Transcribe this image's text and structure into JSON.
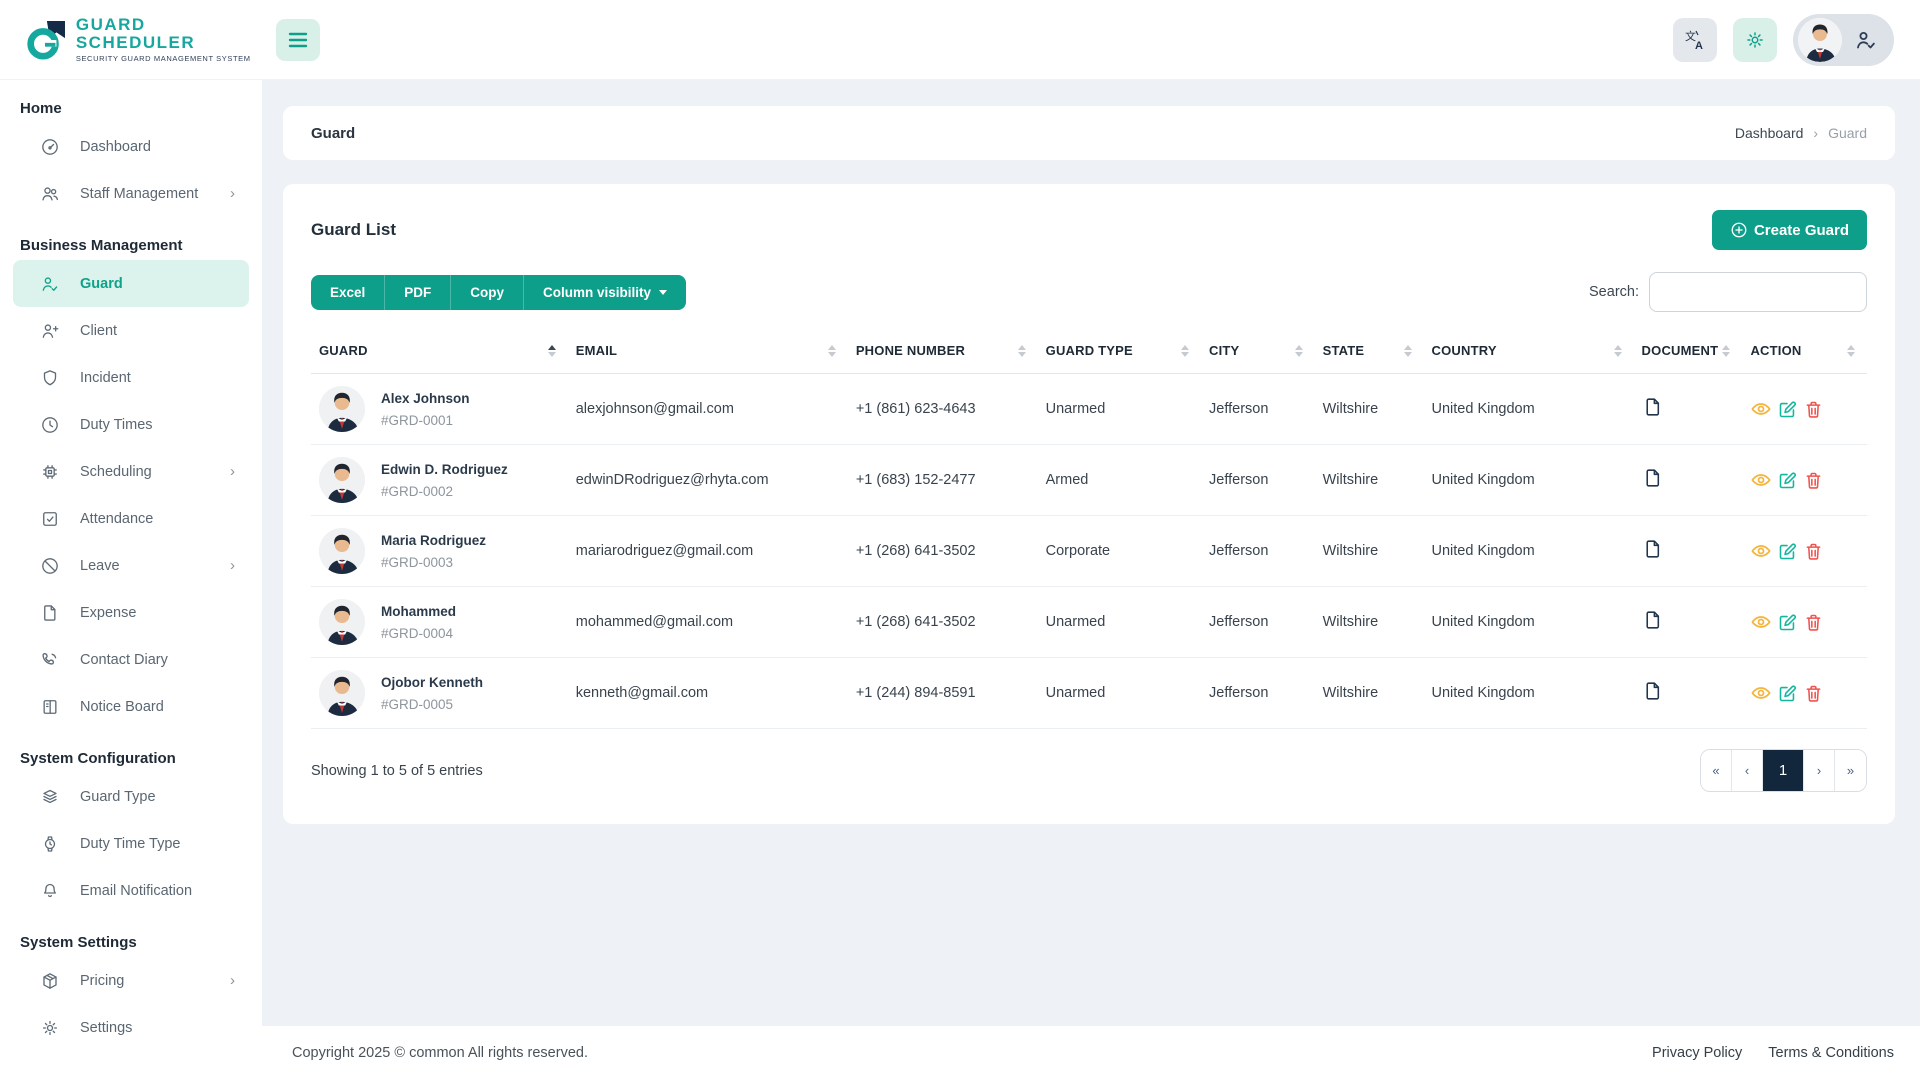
{
  "brand": {
    "title": "GUARD SCHEDULER",
    "subtitle": "SECURITY GUARD MANAGEMENT SYSTEM"
  },
  "topbar": {
    "icons": [
      "hamburger-icon",
      "translate-icon",
      "gear-icon",
      "avatar",
      "user-check-icon"
    ]
  },
  "sidebar": {
    "sections": [
      {
        "label": "Home",
        "items": [
          {
            "label": "Dashboard",
            "icon": "dashboard-icon",
            "chevron": false,
            "active": false
          },
          {
            "label": "Staff Management",
            "icon": "people-icon",
            "chevron": true,
            "active": false
          }
        ]
      },
      {
        "label": "Business Management",
        "items": [
          {
            "label": "Guard",
            "icon": "person-check-icon",
            "chevron": false,
            "active": true
          },
          {
            "label": "Client",
            "icon": "person-plus-icon",
            "chevron": false,
            "active": false
          },
          {
            "label": "Incident",
            "icon": "shield-icon",
            "chevron": false,
            "active": false
          },
          {
            "label": "Duty Times",
            "icon": "clock-icon",
            "chevron": false,
            "active": false
          },
          {
            "label": "Scheduling",
            "icon": "cpu-icon",
            "chevron": true,
            "active": false
          },
          {
            "label": "Attendance",
            "icon": "check-square-icon",
            "chevron": false,
            "active": false
          },
          {
            "label": "Leave",
            "icon": "slash-circle-icon",
            "chevron": true,
            "active": false
          },
          {
            "label": "Expense",
            "icon": "file-icon",
            "chevron": false,
            "active": false
          },
          {
            "label": "Contact Diary",
            "icon": "phone-icon",
            "chevron": false,
            "active": false
          },
          {
            "label": "Notice Board",
            "icon": "board-icon",
            "chevron": false,
            "active": false
          }
        ]
      },
      {
        "label": "System Configuration",
        "items": [
          {
            "label": "Guard Type",
            "icon": "layers-icon",
            "chevron": false,
            "active": false
          },
          {
            "label": "Duty Time Type",
            "icon": "watch-icon",
            "chevron": false,
            "active": false
          },
          {
            "label": "Email Notification",
            "icon": "bell-icon",
            "chevron": false,
            "active": false
          }
        ]
      },
      {
        "label": "System Settings",
        "items": [
          {
            "label": "Pricing",
            "icon": "package-icon",
            "chevron": true,
            "active": false
          },
          {
            "label": "Settings",
            "icon": "gear-icon",
            "chevron": false,
            "active": false
          }
        ]
      }
    ]
  },
  "breadcrumb": {
    "title": "Guard",
    "items": [
      "Dashboard",
      "Guard"
    ],
    "separator": "›"
  },
  "card": {
    "title": "Guard List",
    "create_label": "Create Guard"
  },
  "toolbar": {
    "export_buttons": [
      "Excel",
      "PDF",
      "Copy"
    ],
    "colvis_label": "Column visibility",
    "search_label": "Search:",
    "search_value": ""
  },
  "table": {
    "headers": [
      "GUARD",
      "EMAIL",
      "PHONE NUMBER",
      "GUARD TYPE",
      "CITY",
      "STATE",
      "COUNTRY",
      "DOCUMENT",
      "ACTION"
    ],
    "rows": [
      {
        "name": "Alex Johnson",
        "id": "#GRD-0001",
        "email": "alexjohnson@gmail.com",
        "phone": "+1 (861) 623-4643",
        "type": "Unarmed",
        "city": "Jefferson",
        "state": "Wiltshire",
        "country": "United Kingdom"
      },
      {
        "name": "Edwin D. Rodriguez",
        "id": "#GRD-0002",
        "email": "edwinDRodriguez@rhyta.com",
        "phone": "+1 (683) 152-2477",
        "type": "Armed",
        "city": "Jefferson",
        "state": "Wiltshire",
        "country": "United Kingdom"
      },
      {
        "name": "Maria Rodriguez",
        "id": "#GRD-0003",
        "email": "mariarodriguez@gmail.com",
        "phone": "+1 (268) 641-3502",
        "type": "Corporate",
        "city": "Jefferson",
        "state": "Wiltshire",
        "country": "United Kingdom"
      },
      {
        "name": "Mohammed",
        "id": "#GRD-0004",
        "email": "mohammed@gmail.com",
        "phone": "+1 (268) 641-3502",
        "type": "Unarmed",
        "city": "Jefferson",
        "state": "Wiltshire",
        "country": "United Kingdom"
      },
      {
        "name": "Ojobor Kenneth",
        "id": "#GRD-0005",
        "email": "kenneth@gmail.com",
        "phone": "+1 (244) 894-8591",
        "type": "Unarmed",
        "city": "Jefferson",
        "state": "Wiltshire",
        "country": "United Kingdom"
      }
    ],
    "summary": "Showing 1 to 5 of 5 entries",
    "sorted_column": "GUARD"
  },
  "pagination": {
    "first": "«",
    "prev": "‹",
    "page": "1",
    "next": "›",
    "last": "»"
  },
  "footer": {
    "copyright": "Copyright 2025 © common All rights reserved.",
    "links": [
      "Privacy Policy",
      "Terms & Conditions"
    ]
  },
  "colors": {
    "primary": "#0E9F8B",
    "primary_light": "#DCF2EC",
    "navy": "#12263C",
    "view_icon": "#F5B43C",
    "edit_icon": "#12B79E",
    "delete_icon": "#F0534F",
    "background": "#EEF1F5"
  }
}
